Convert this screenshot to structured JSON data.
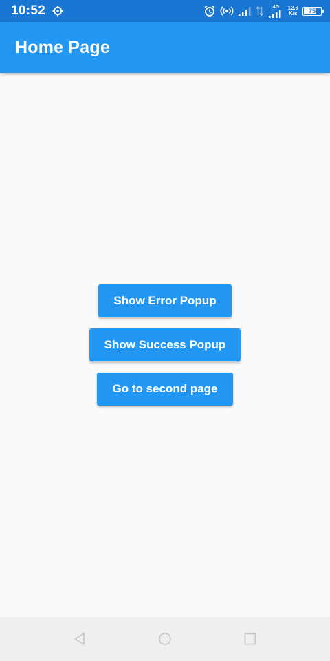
{
  "status_bar": {
    "time": "10:52",
    "network_label": "4G",
    "speed_value": "12.6",
    "speed_unit": "K/s",
    "battery_level": "75",
    "battery_fraction": 0.75,
    "icons": [
      "settings-gear-icon",
      "alarm-icon",
      "hotspot-icon",
      "signal-icon",
      "data-arrows-icon",
      "signal-4g-icon",
      "battery-icon"
    ]
  },
  "app_bar": {
    "title": "Home Page",
    "color": "#2196f3"
  },
  "buttons": {
    "error_label": "Show Error Popup",
    "success_label": "Show Success Popup",
    "second_page_label": "Go to second page"
  },
  "nav_bar": {
    "icons": [
      "back-triangle-icon",
      "home-circle-icon",
      "recents-square-icon"
    ]
  },
  "colors": {
    "primary": "#2196f3",
    "status_bar": "#1976d2",
    "background": "#fafafa"
  }
}
